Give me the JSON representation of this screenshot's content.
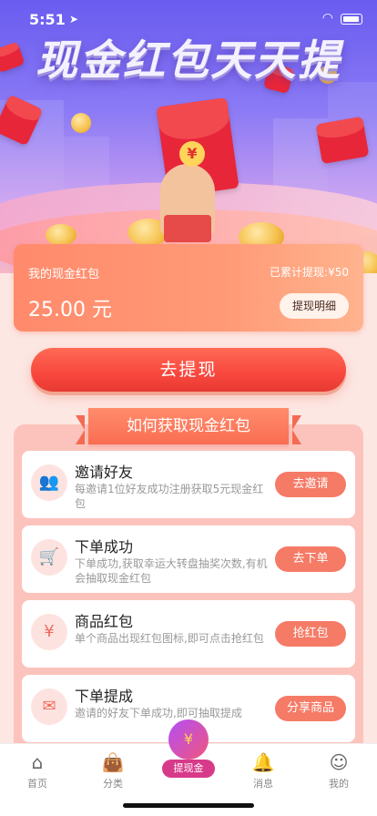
{
  "status_bar": {
    "time": "5:51"
  },
  "banner": {
    "title": "现金红包天天提",
    "badge_symbol": "¥"
  },
  "wallet": {
    "label": "我的现金红包",
    "total_label": "已累计提现:",
    "total_value": "¥50",
    "amount": "25.00 元",
    "detail_button": "提现明细"
  },
  "withdraw_button": "去提现",
  "section_title": "如何获取现金红包",
  "tasks": [
    {
      "title": "邀请好友",
      "desc": "每邀请1位好友成功注册获取5元现金红包",
      "button": "去邀请",
      "icon": "invite-users-icon"
    },
    {
      "title": "下单成功",
      "desc": "下单成功,获取幸运大转盘抽奖次数,有机会抽取现金红包",
      "button": "去下单",
      "icon": "cart-icon"
    },
    {
      "title": "商品红包",
      "desc": "单个商品出现红包图标,即可点击抢红包",
      "button": "抢红包",
      "icon": "money-bag-icon"
    },
    {
      "title": "下单提成",
      "desc": "邀请的好友下单成功,即可抽取提成",
      "button": "分享商品",
      "icon": "red-envelope-icon"
    }
  ],
  "tabbar": {
    "home": "首页",
    "category": "分类",
    "center": "提现金",
    "messages": "消息",
    "mine": "我的"
  },
  "colors": {
    "accent": "#f8473e",
    "card": "#ff9a76",
    "button": "#f57b67"
  }
}
